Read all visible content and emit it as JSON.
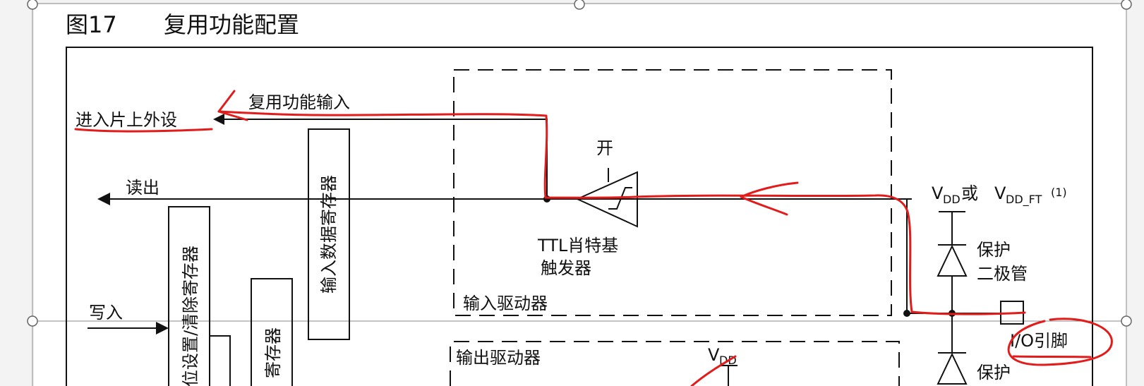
{
  "figure": {
    "number": "图17",
    "title": "复用功能配置"
  },
  "labels": {
    "to_peripheral": "进入片上外设",
    "alt_func_input": "复用功能输入",
    "read_out": "读出",
    "write_in": "写入",
    "input_data_register": "输入数据寄存器",
    "bit_set_reset_register": "位设置/清除寄存器",
    "output_data_register_partial": "寄存器",
    "on": "开",
    "ttl_schmitt_1": "TTL肖特基",
    "ttl_schmitt_2": "触发器",
    "input_driver": "输入驱动器",
    "output_driver": "输出驱动器",
    "vdd_main": "V",
    "vdd_sub": "DD",
    "supply_v1": "V",
    "supply_dd": "DD",
    "supply_or": " 或 ",
    "supply_v2": "V",
    "supply_ddft": "DD_FT",
    "supply_note": "(1)",
    "protect_diode_1": "保护",
    "protect_diode_2": "二极管",
    "protect_lower": "保护",
    "io_pin": "I/O引脚"
  },
  "annotations": {
    "highlight_color": "#e21b1b",
    "description": "Hand-drawn red path tracing I/O pin → Schmitt trigger → alternate function input → on-chip peripheral"
  }
}
